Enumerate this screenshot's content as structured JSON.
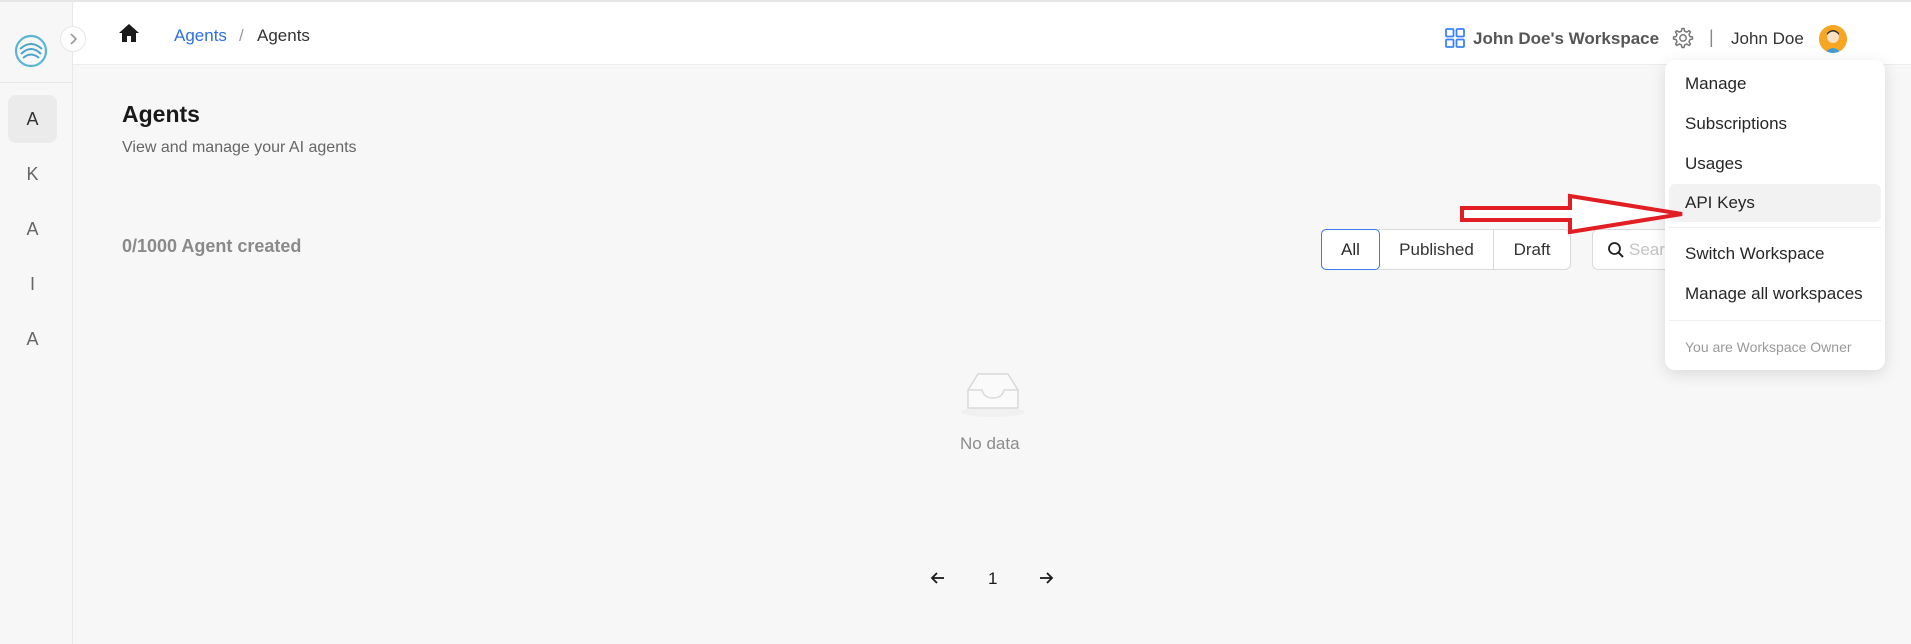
{
  "sidebar": {
    "items": [
      {
        "label": "A",
        "active": true
      },
      {
        "label": "K"
      },
      {
        "label": "A"
      },
      {
        "label": "I"
      },
      {
        "label": "A"
      }
    ],
    "expand_icon": "chevron-right-icon"
  },
  "header": {
    "breadcrumb": {
      "link": "Agents",
      "separator": "/",
      "current": "Agents"
    },
    "workspace_name": "John Doe's Workspace",
    "divider": "|",
    "user_name": "John Doe"
  },
  "main": {
    "title": "Agents",
    "subtitle": "View and manage your AI agents",
    "count_text": "0/1000 Agent created",
    "filters": [
      {
        "label": "All",
        "active": true
      },
      {
        "label": "Published"
      },
      {
        "label": "Draft"
      }
    ],
    "search": {
      "placeholder": "Search"
    },
    "empty_text": "No data",
    "pagination": {
      "current": "1"
    }
  },
  "dropdown": {
    "items": [
      "Manage",
      "Subscriptions",
      "Usages",
      "API Keys",
      "Switch Workspace",
      "Manage all workspaces"
    ],
    "note": "You are Workspace Owner"
  },
  "colors": {
    "accent": "#2f6fe0",
    "annotation_arrow": "#e01e24"
  }
}
